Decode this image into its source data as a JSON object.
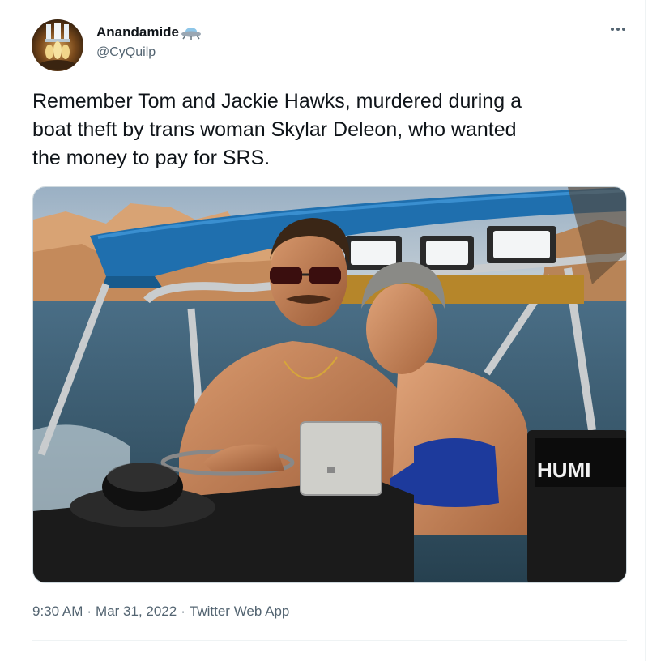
{
  "tweet": {
    "display_name": "Anandamide",
    "handle": "@CyQuilp",
    "text": "Remember Tom and Jackie Hawks, murdered during a\nboat theft by trans woman Skylar Deleon, who wanted\nthe money to pay for SRS.",
    "timestamp_time": "9:30 AM",
    "timestamp_date": "Mar 31, 2022",
    "source_app": "Twitter Web App",
    "separator": "·",
    "name_emoji": "ufo-emoji",
    "more_icon": "more-horizontal-icon"
  },
  "photo": {
    "description_icon": "photo-boat-couple",
    "fishfinder_label": "HUMI"
  },
  "colors": {
    "text_primary": "#0f1419",
    "text_secondary": "#536471",
    "border": "#cfd9de"
  }
}
